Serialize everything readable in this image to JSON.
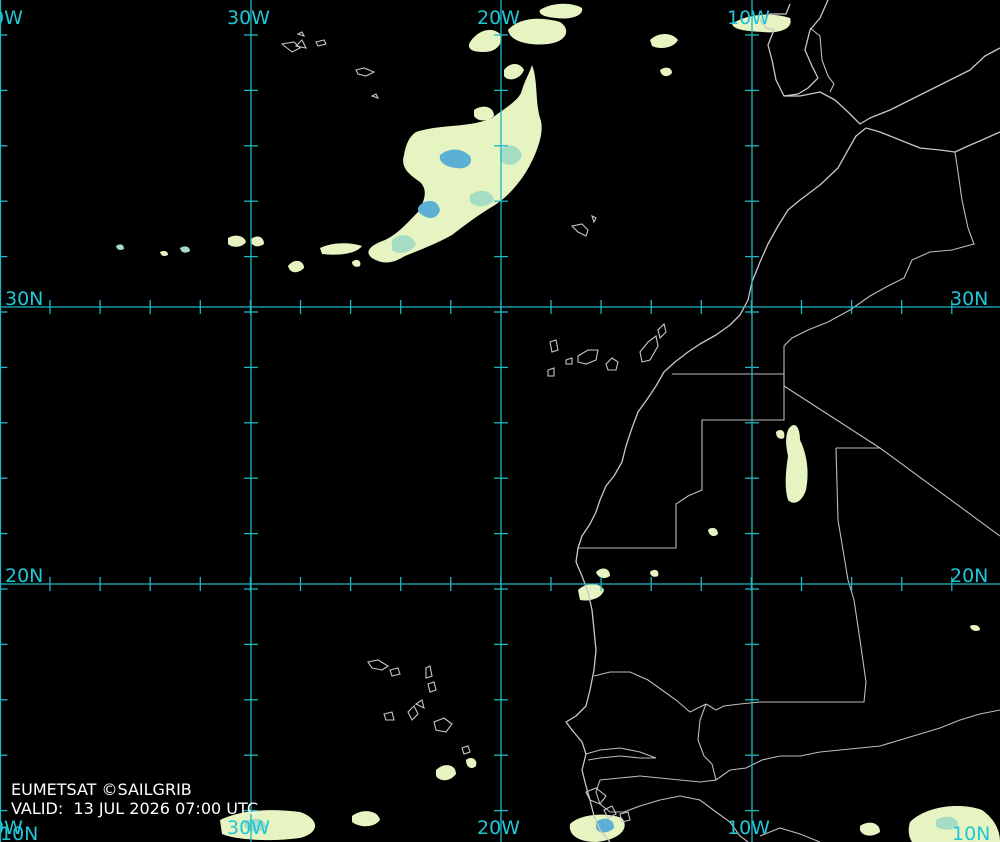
{
  "source": {
    "credit": "EUMETSAT ©SAILGRIB",
    "valid_label": "VALID:",
    "valid_time": "13 JUL 2026 07:00 UTC"
  },
  "grid": {
    "longitudes": [
      {
        "top": "0W",
        "bottom": "0W"
      },
      {
        "top": "30W",
        "bottom": "30W"
      },
      {
        "top": "20W",
        "bottom": "20W"
      },
      {
        "top": "10W",
        "bottom": "10W"
      },
      {
        "top": "",
        "bottom": "10N"
      }
    ],
    "latitudes": [
      {
        "left": "30N",
        "right": "30N"
      },
      {
        "left": "20N",
        "right": "20N"
      },
      {
        "left": "10N",
        "right": ""
      }
    ]
  },
  "colors": {
    "grid": "#1fb8c4",
    "cloud_light": "#e6f4c2",
    "cloud_dense": "#5cb0d4",
    "coastline": "#c8c8c8",
    "background": "#000000"
  }
}
